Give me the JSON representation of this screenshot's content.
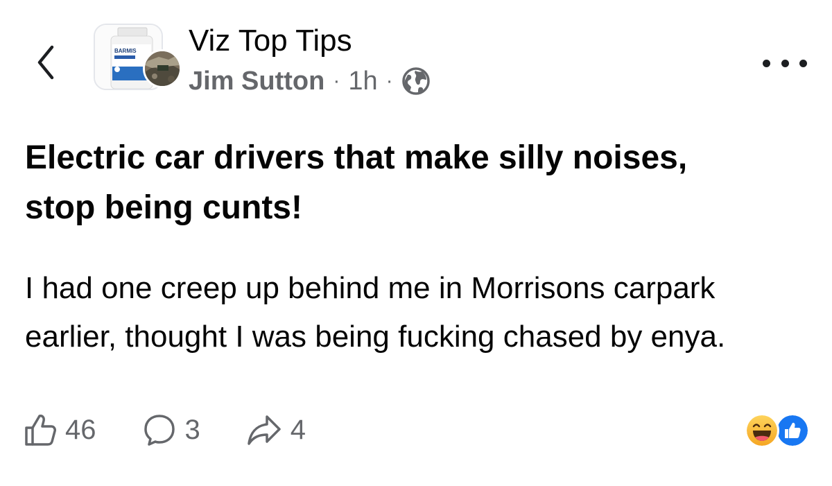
{
  "header": {
    "group_name": "Viz Top Tips",
    "author": "Jim Sutton",
    "separator": "·",
    "time": "1h",
    "group_avatar_text": "BARMIS",
    "back_icon": "chevron-left-icon",
    "audience_icon": "globe-icon",
    "more_icon": "ellipsis-icon"
  },
  "post": {
    "title": "Electric car drivers that make silly noises, stop being cunts!",
    "body": "I had one creep up behind me in Morrisons carpark earlier, thought I was being fucking chased by enya."
  },
  "actions": {
    "like_count": "46",
    "comment_count": "3",
    "share_count": "4",
    "like_icon": "thumbs-up-outline-icon",
    "comment_icon": "speech-bubble-icon",
    "share_icon": "share-arrow-icon"
  },
  "reactions": {
    "items": [
      "haha",
      "like"
    ],
    "haha_color": "#f7b125",
    "like_color": "#1877f2"
  },
  "colors": {
    "text_primary": "#050505",
    "text_secondary": "#65676b",
    "accent": "#1877f2"
  }
}
